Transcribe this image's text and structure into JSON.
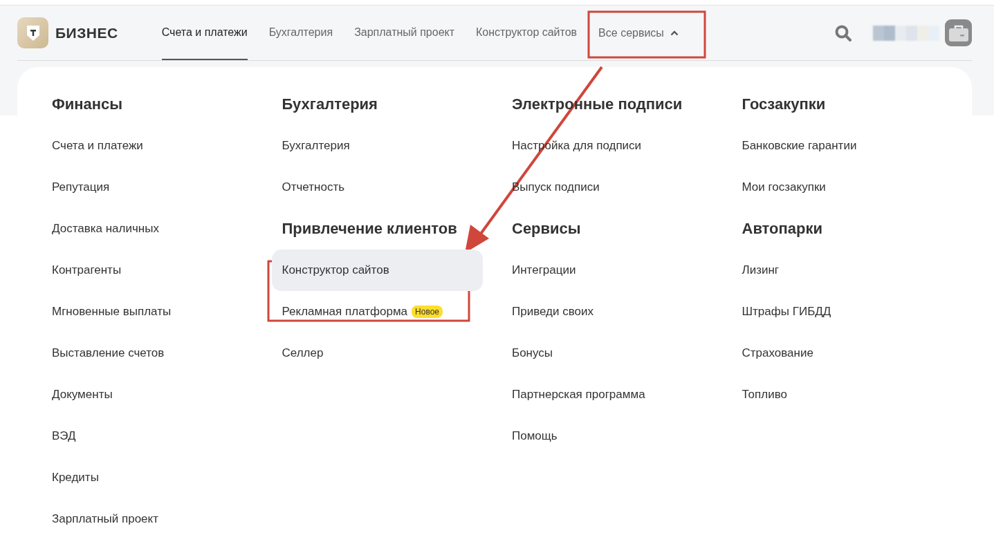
{
  "header": {
    "logo_text": "БИЗНЕС",
    "nav": [
      {
        "label": "Счета и платежи",
        "selected": true
      },
      {
        "label": "Бухгалтерия",
        "selected": false
      },
      {
        "label": "Зарплатный проект",
        "selected": false
      },
      {
        "label": "Конструктор сайтов",
        "selected": false
      }
    ],
    "services_menu": {
      "label": "Все сервисы",
      "expanded": true
    }
  },
  "menu": {
    "columns": [
      [
        {
          "title": "Финансы",
          "items": [
            {
              "label": "Счета и платежи",
              "highlighted": false
            },
            {
              "label": "Репутация",
              "highlighted": false
            },
            {
              "label": "Доставка наличных",
              "highlighted": false
            },
            {
              "label": "Контрагенты",
              "highlighted": false
            },
            {
              "label": "Мгновенные выплаты",
              "highlighted": false
            },
            {
              "label": "Выставление счетов",
              "highlighted": false
            },
            {
              "label": "Документы",
              "highlighted": false
            },
            {
              "label": "ВЭД",
              "highlighted": false
            },
            {
              "label": "Кредиты",
              "highlighted": false
            },
            {
              "label": "Зарплатный проект",
              "highlighted": false
            }
          ]
        }
      ],
      [
        {
          "title": "Бухгалтерия",
          "items": [
            {
              "label": "Бухгалтерия",
              "highlighted": false
            },
            {
              "label": "Отчетность",
              "highlighted": false
            }
          ]
        },
        {
          "title": "Привлечение клиентов",
          "items": [
            {
              "label": "Конструктор сайтов",
              "highlighted": true
            },
            {
              "label": "Рекламная платформа",
              "highlighted": false,
              "badge": "Новое"
            },
            {
              "label": "Селлер",
              "highlighted": false
            }
          ]
        }
      ],
      [
        {
          "title": "Электронные подписи",
          "items": [
            {
              "label": "Настройка для подписи",
              "highlighted": false
            },
            {
              "label": "Выпуск подписи",
              "highlighted": false
            }
          ]
        },
        {
          "title": "Сервисы",
          "items": [
            {
              "label": "Интеграции",
              "highlighted": false
            },
            {
              "label": "Приведи своих",
              "highlighted": false
            },
            {
              "label": "Бонусы",
              "highlighted": false
            },
            {
              "label": "Партнерская программа",
              "highlighted": false
            },
            {
              "label": "Помощь",
              "highlighted": false
            }
          ]
        }
      ],
      [
        {
          "title": "Госзакупки",
          "items": [
            {
              "label": "Банковские гарантии",
              "highlighted": false
            },
            {
              "label": "Мои госзакупки",
              "highlighted": false
            }
          ]
        },
        {
          "title": "Автопарки",
          "items": [
            {
              "label": "Лизинг",
              "highlighted": false
            },
            {
              "label": "Штрафы ГИБДД",
              "highlighted": false
            },
            {
              "label": "Страхование",
              "highlighted": false
            },
            {
              "label": "Топливо",
              "highlighted": false
            }
          ]
        }
      ]
    ]
  }
}
